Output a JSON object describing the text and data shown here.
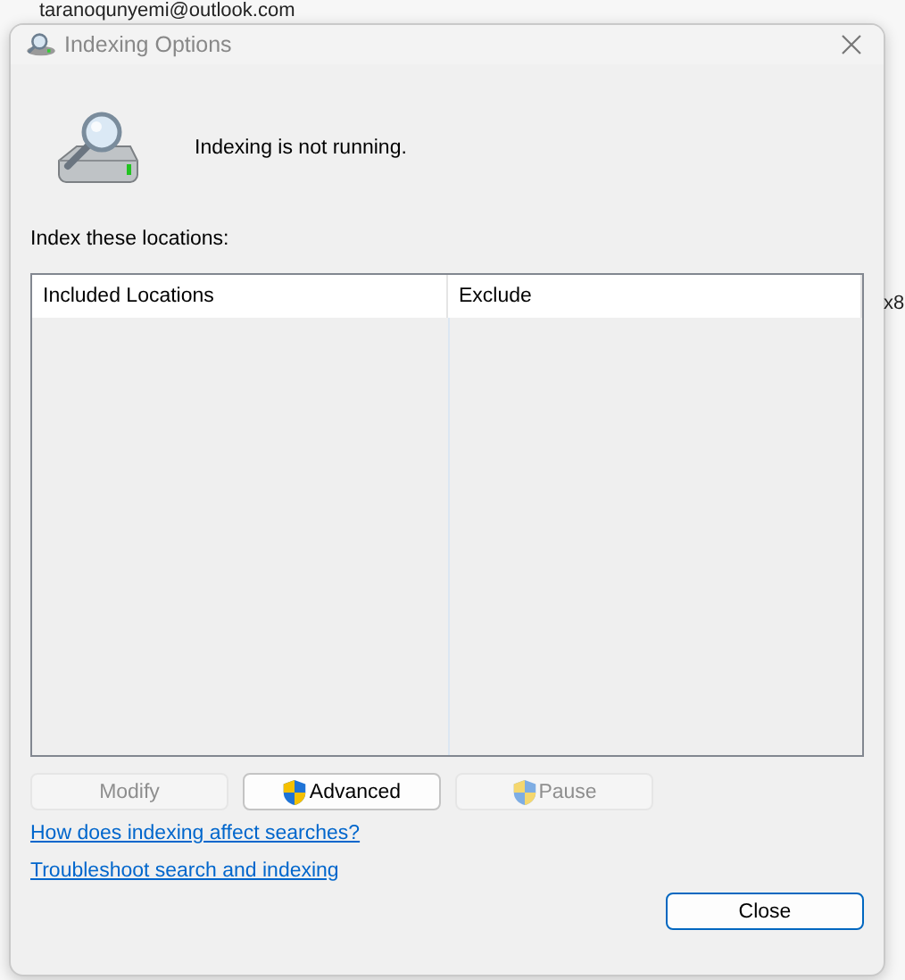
{
  "background": {
    "account": "taranoqunyemi@outlook.com",
    "fragment": "x8"
  },
  "window": {
    "title": "Indexing Options"
  },
  "status": "Indexing is not running.",
  "locations_label": "Index these locations:",
  "table": {
    "columns": [
      "Included Locations",
      "Exclude"
    ]
  },
  "buttons": [
    {
      "label": "Modify",
      "disabled": true,
      "shield": false
    },
    {
      "label": "Advanced",
      "disabled": false,
      "shield": true
    },
    {
      "label": "Pause",
      "disabled": true,
      "shield": true
    }
  ],
  "links": [
    "How does indexing affect searches?",
    "Troubleshoot search and indexing"
  ],
  "close_button": "Close"
}
